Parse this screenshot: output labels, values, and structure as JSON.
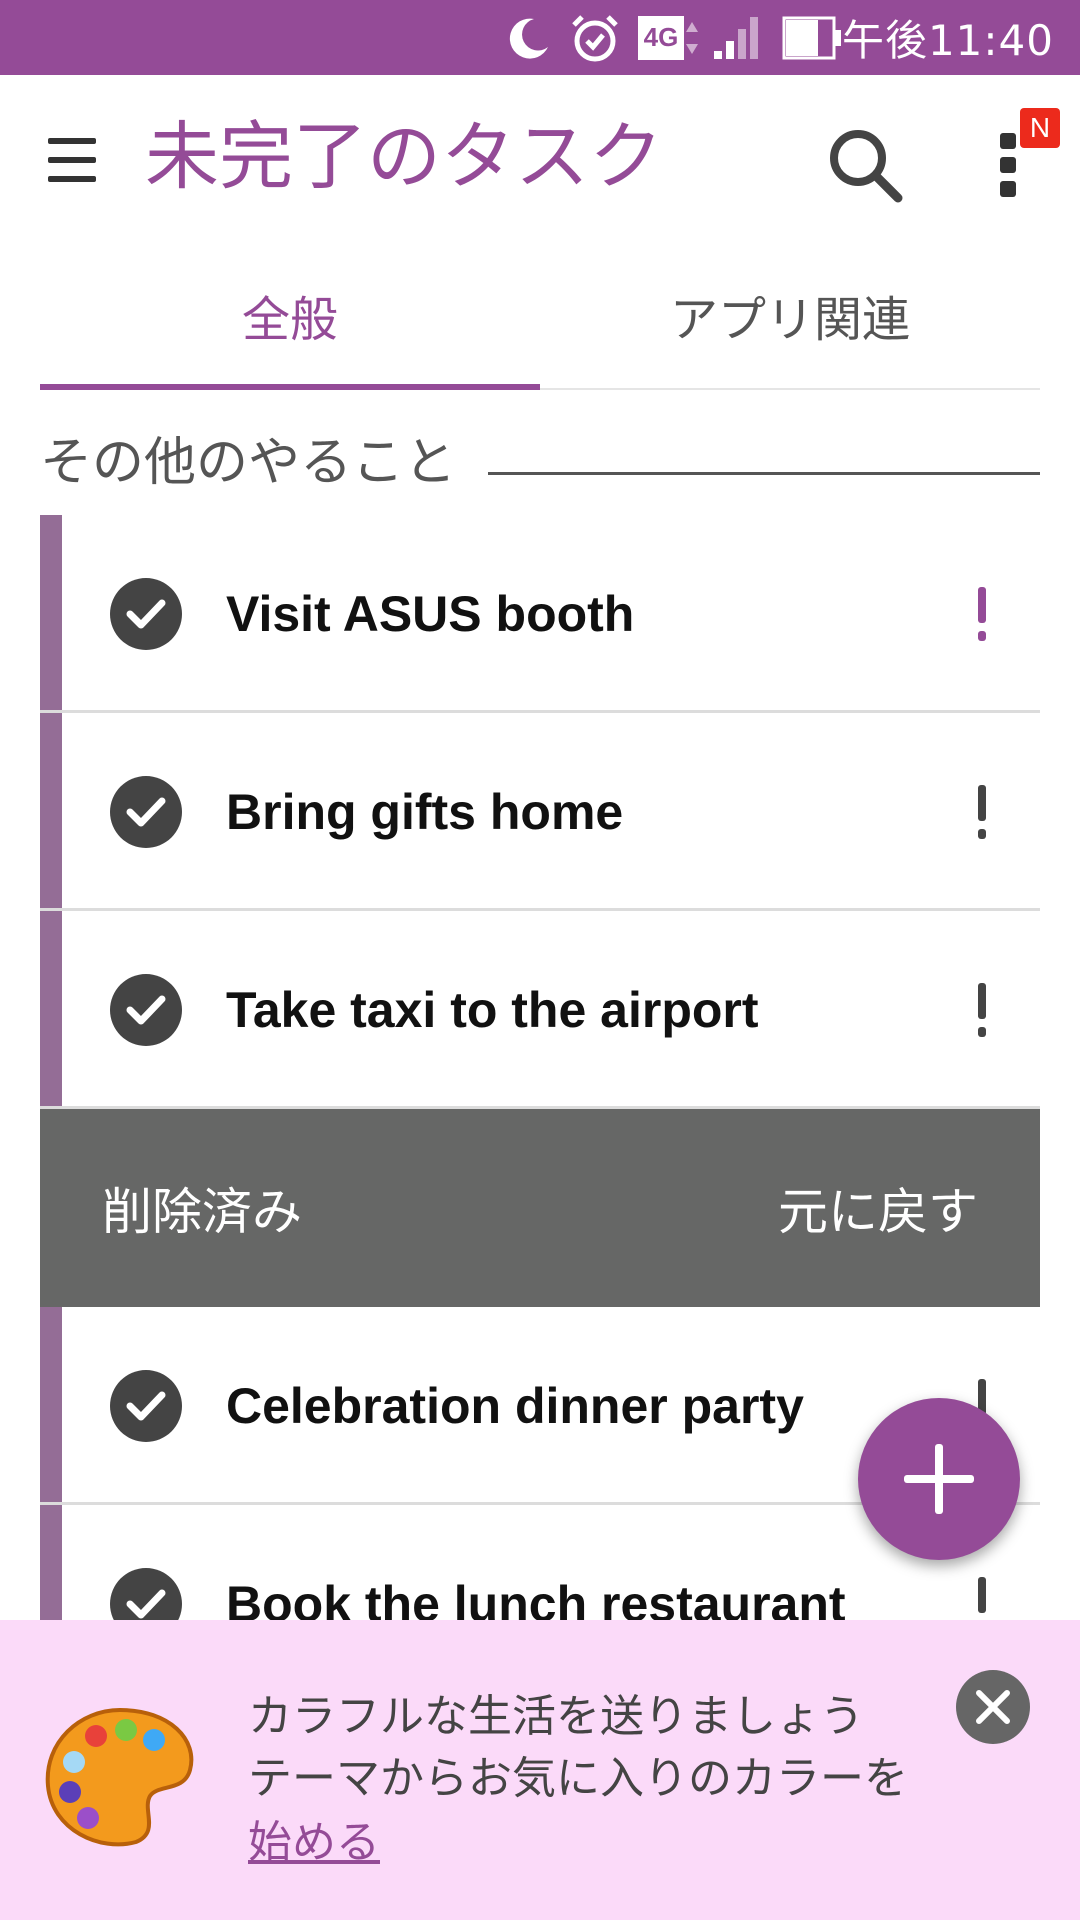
{
  "status_bar": {
    "time": "午後11:40",
    "network": "4G",
    "icons": [
      "moon-icon",
      "alarm-icon",
      "network-4g-icon",
      "signal-icon",
      "battery-icon"
    ]
  },
  "app_bar": {
    "title": "未完了のタスク",
    "menu_icon": "hamburger-menu-icon",
    "search_icon": "search-icon",
    "more_icon": "more-vertical-icon",
    "badge": "N"
  },
  "tabs": [
    {
      "label": "全般",
      "selected": true
    },
    {
      "label": "アプリ関連",
      "selected": false
    }
  ],
  "section": {
    "title": "その他のやること"
  },
  "tasks": [
    {
      "text": "Visit ASUS booth",
      "priority_color": "#944b97"
    },
    {
      "text": "Bring gifts home",
      "priority_color": "#444444"
    },
    {
      "text": "Take taxi to the airport",
      "priority_color": "#444444"
    },
    {
      "text": "Celebration dinner party",
      "priority_color": "#444444"
    },
    {
      "text": "Book the lunch restaurant",
      "priority_color": "#444444"
    }
  ],
  "deleted_bar": {
    "label": "削除済み",
    "undo": "元に戻す"
  },
  "promo": {
    "line1": "カラフルな生活を送りましょう",
    "line2": "テーマからお気に入りのカラーを",
    "link": "始める",
    "icon": "palette-icon"
  },
  "colors": {
    "accent": "#944b97",
    "task_accent": "#946d96",
    "deleted_bg": "#666766",
    "promo_bg": "#fbdaf9"
  }
}
